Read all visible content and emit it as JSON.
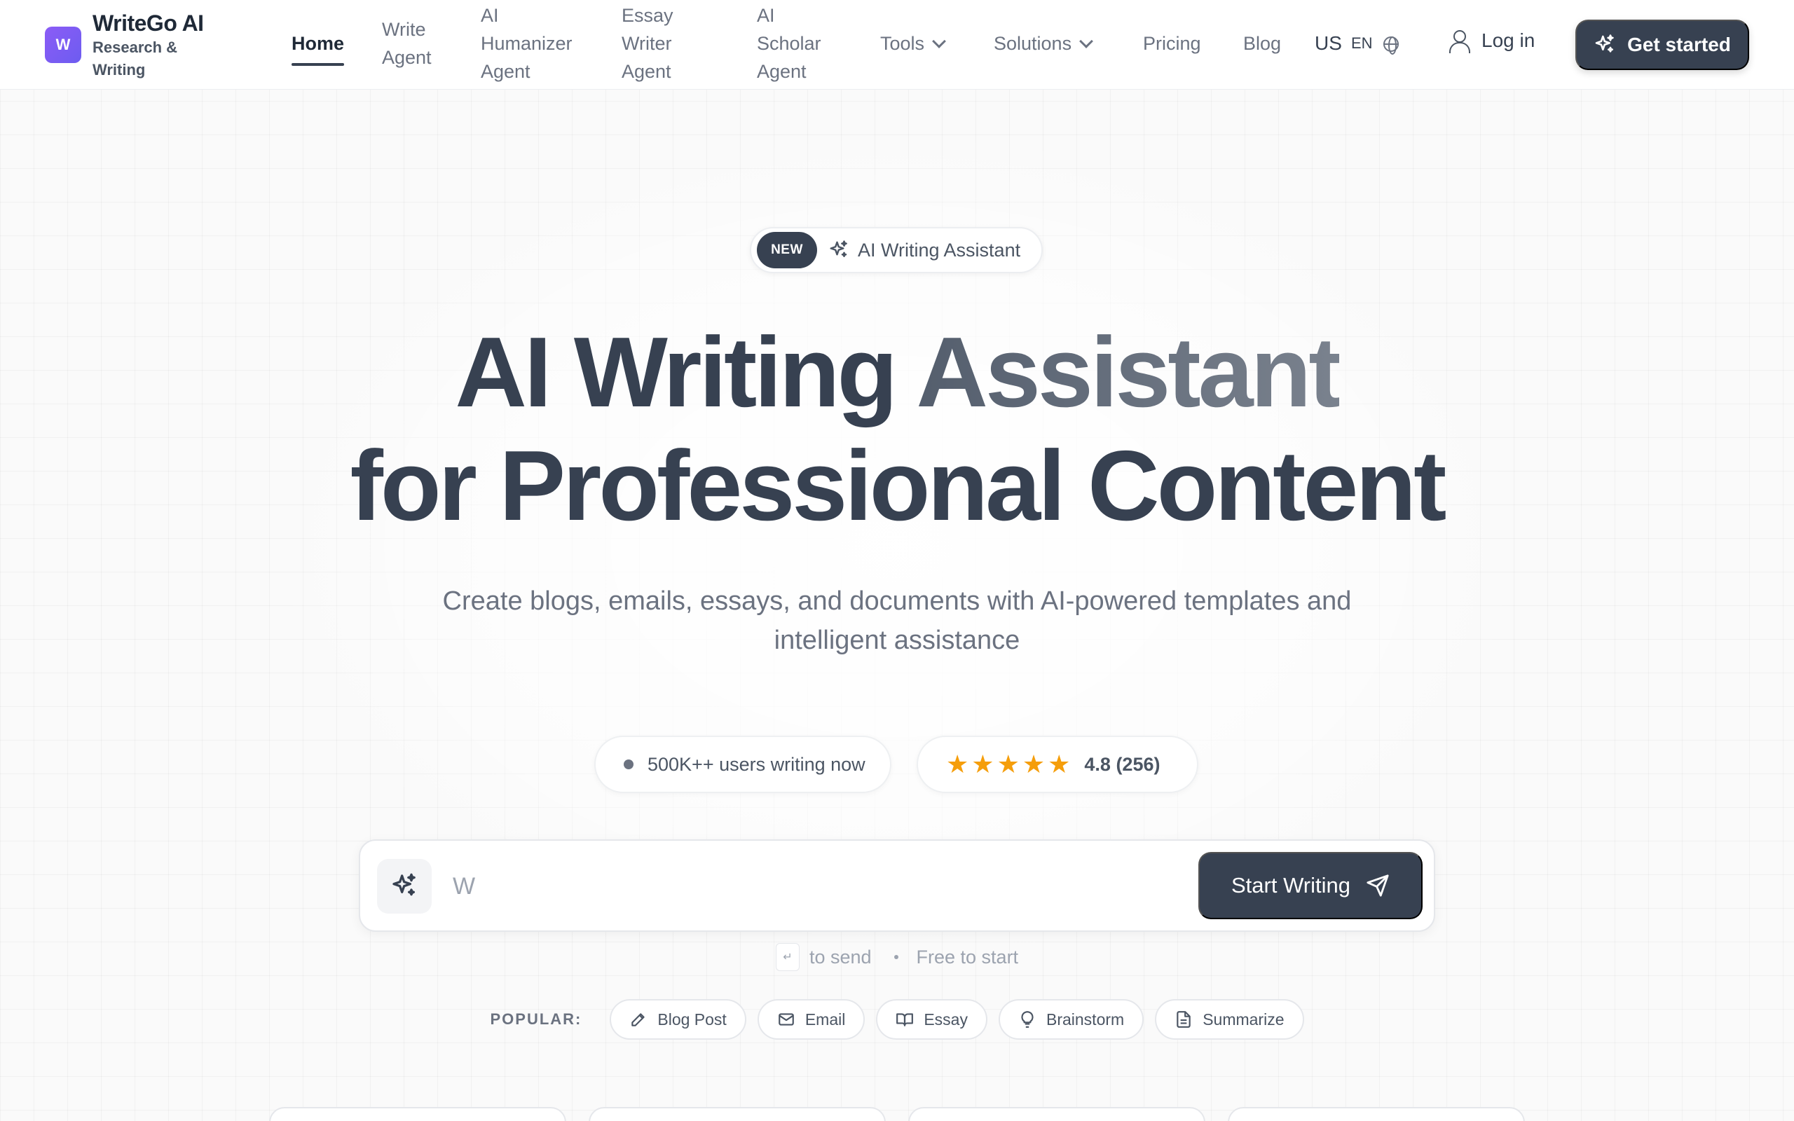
{
  "brand": {
    "title": "WriteGo AI",
    "subtitle": "Research & Writing",
    "mark": "W"
  },
  "nav": {
    "items": [
      {
        "label": "Home"
      },
      {
        "label": "Write Agent"
      },
      {
        "label": "AI Humanizer Agent"
      },
      {
        "label": "Essay Writer Agent"
      },
      {
        "label": "AI Scholar Agent"
      },
      {
        "label": "Tools"
      },
      {
        "label": "Solutions"
      },
      {
        "label": "Pricing"
      },
      {
        "label": "Blog"
      }
    ],
    "region": "US",
    "language": "EN",
    "login": "Log in",
    "cta": "Get started"
  },
  "hero": {
    "badge_new": "NEW",
    "badge_text": "AI Writing Assistant",
    "title_line1_a": "AI Writing",
    "title_line1_b": "Assistant",
    "title_line2": "for Professional Content",
    "subtitle": "Create blogs, emails, essays, and documents with AI-powered templates and intelligent assistance",
    "users_text": "500K++ users writing now",
    "rating_stars": 5,
    "rating_text": "4.8 (256)"
  },
  "prompt": {
    "value": "W",
    "submit": "Start Writing",
    "hint_key": "↵",
    "hint_send": "to send",
    "hint_free": "Free to start"
  },
  "popular": {
    "label": "POPULAR:",
    "chips": [
      "Blog Post",
      "Email",
      "Essay",
      "Brainstorm",
      "Summarize"
    ]
  },
  "colors": {
    "primary": "#374151",
    "accent": "#7c5cf5",
    "star": "#f59e0b"
  }
}
